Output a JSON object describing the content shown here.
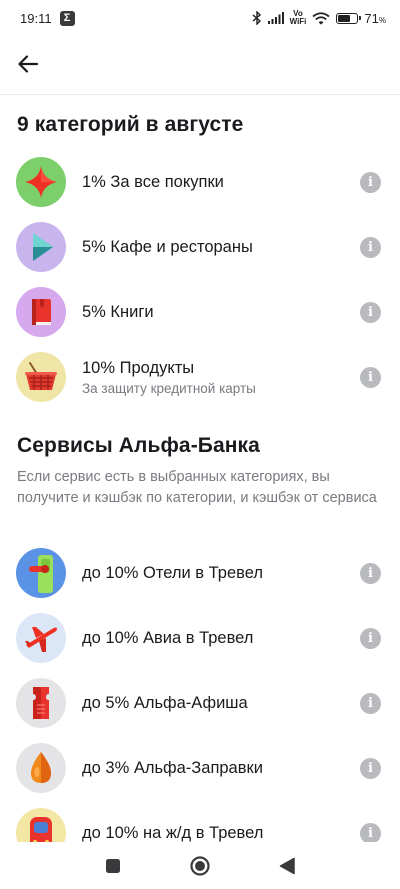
{
  "status_bar": {
    "time": "19:11",
    "notification_glyph": "Σ",
    "vowifi_top": "Vo",
    "vowifi_bottom": "WiFi",
    "battery_percent": "71",
    "battery_unit": "%",
    "battery_level": 0.71
  },
  "categories_section": {
    "title": "9 категорий в августе",
    "items": [
      {
        "title": "1% За все покупки",
        "subtitle": "",
        "icon": "star-icon",
        "bg": "#7ccf6a"
      },
      {
        "title": "5% Кафе и рестораны",
        "subtitle": "",
        "icon": "play-icon",
        "bg": "#c8b5ee"
      },
      {
        "title": "5% Книги",
        "subtitle": "",
        "icon": "book-icon",
        "bg": "#d6a8ee"
      },
      {
        "title": "10% Продукты",
        "subtitle": "За защиту кредитной карты",
        "icon": "basket-icon",
        "bg": "#efe5a6"
      }
    ]
  },
  "services_section": {
    "title": "Сервисы Альфа-Банка",
    "description": "Если сервис есть в выбранных категориях, вы получите и кэшбэк по категории, и кэшбэк от сервиса",
    "items": [
      {
        "title": "до 10% Отели в Тревел",
        "icon": "door-handle-icon",
        "bg": "#5a92e6"
      },
      {
        "title": "до 10% Авиа в Тревел",
        "icon": "airplane-icon",
        "bg": "#dbe7f7"
      },
      {
        "title": "до 5% Альфа-Афиша",
        "icon": "ticket-icon",
        "bg": "#e4e4e6"
      },
      {
        "title": "до 3% Альфа-Заправки",
        "icon": "fuel-drop-icon",
        "bg": "#e4e4e6"
      },
      {
        "title": "до 10% на ж/д в Тревел",
        "icon": "train-icon",
        "bg": "#f4e7a6"
      }
    ]
  },
  "info_glyph": "i",
  "colors": {
    "accent_red": "#ef3124",
    "text_primary": "#1b1b1f",
    "text_secondary": "#7a7a80",
    "info_gray": "#b9babe"
  }
}
